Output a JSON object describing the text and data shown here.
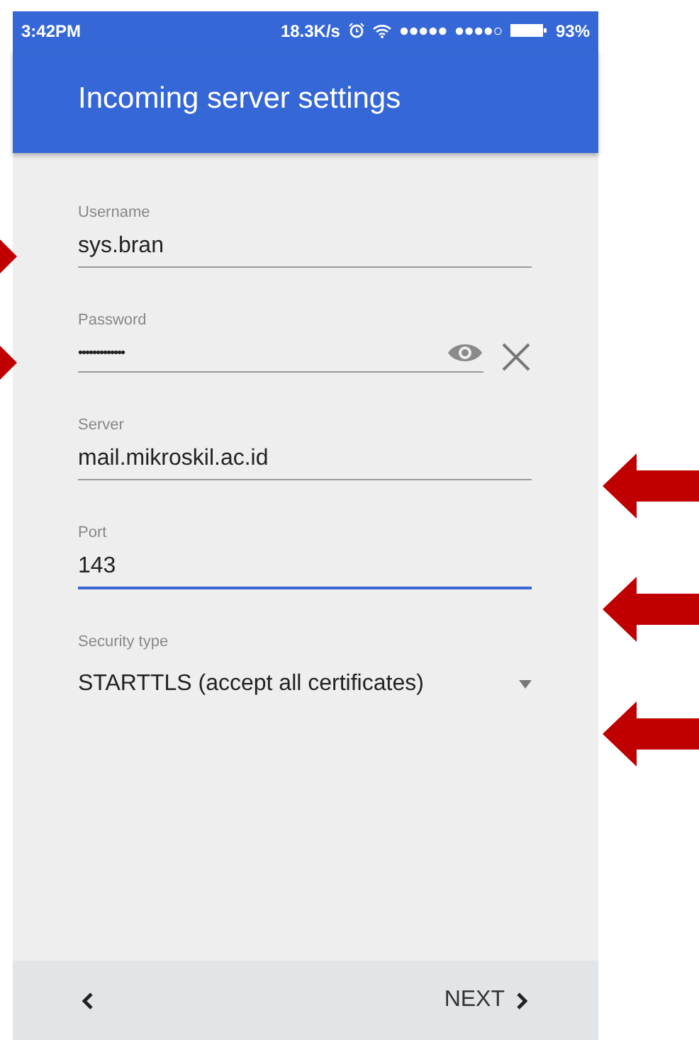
{
  "status_bar": {
    "time": "3:42PM",
    "speed": "18.3K/s",
    "battery": "93%"
  },
  "app_bar": {
    "title": "Incoming server settings"
  },
  "fields": [
    {
      "kind": "text",
      "label": "Username",
      "value": "sys.bran",
      "focused": false
    },
    {
      "kind": "password",
      "label": "Password",
      "value": "•••••••••••••",
      "focused": false
    },
    {
      "kind": "text",
      "label": "Server",
      "value": "mail.mikroskil.ac.id",
      "focused": false
    },
    {
      "kind": "text",
      "label": "Port",
      "value": "143",
      "focused": true
    },
    {
      "kind": "dropdown",
      "label": "Security type",
      "value": "STARTTLS (accept all certificates)",
      "focused": false
    }
  ],
  "bottom_bar": {
    "next": "NEXT"
  }
}
